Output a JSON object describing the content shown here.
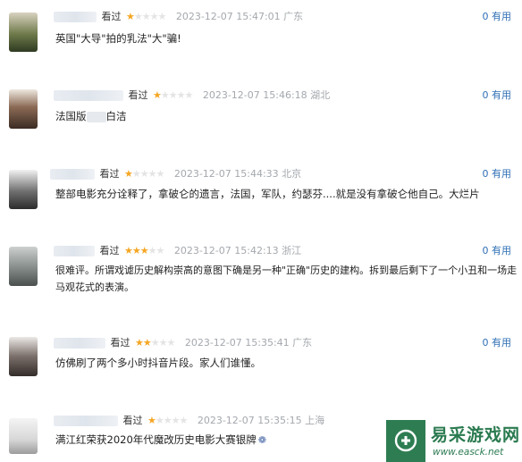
{
  "reviews": [
    {
      "watched": "看过",
      "stars": 1,
      "time": "2023-12-07 15:47:01",
      "location": "广东",
      "useful": "0 有用",
      "text": "英国\"大导\"拍的乳法\"大\"骗!"
    },
    {
      "watched": "看过",
      "stars": 1,
      "time": "2023-12-07 15:46:18",
      "location": "湖北",
      "useful": "0 有用",
      "text_before": "法国版",
      "text_after": "白洁"
    },
    {
      "watched": "看过",
      "stars": 1,
      "time": "2023-12-07 15:44:33",
      "location": "北京",
      "useful": "0 有用",
      "text": "整部电影充分诠释了，拿破仑的遗言，法国，军队，约瑟芬....就是没有拿破仑他自己。大烂片"
    },
    {
      "watched": "看过",
      "stars": 3,
      "time": "2023-12-07 15:42:13",
      "location": "浙江",
      "useful": "0 有用",
      "line1": "很难评。所谓戏谑历史解构崇高的意图下确是另一种\"正确\"历史的建构。拆到最后剩下了一个小丑和一场走",
      "line2": "马观花式的表演。"
    },
    {
      "watched": "看过",
      "stars": 2,
      "time": "2023-12-07 15:35:41",
      "location": "广东",
      "useful": "0 有用",
      "text": "仿佛刷了两个多小时抖音片段。家人们谁懂。"
    },
    {
      "watched": "看过",
      "stars": 1,
      "time": "2023-12-07 15:35:15",
      "location": "上海",
      "useful": "",
      "text": "满江红荣获2020年代魔改历史电影大赛银牌",
      "badge_icon": "shield-medal-icon"
    }
  ],
  "watermark": {
    "name": "易采游戏网",
    "url": "www.easck.net",
    "icon": "game-controller-logo-icon",
    "color": "#2e7d52"
  },
  "colors": {
    "star": "#f5a623",
    "useful": "#2f6fb5"
  }
}
